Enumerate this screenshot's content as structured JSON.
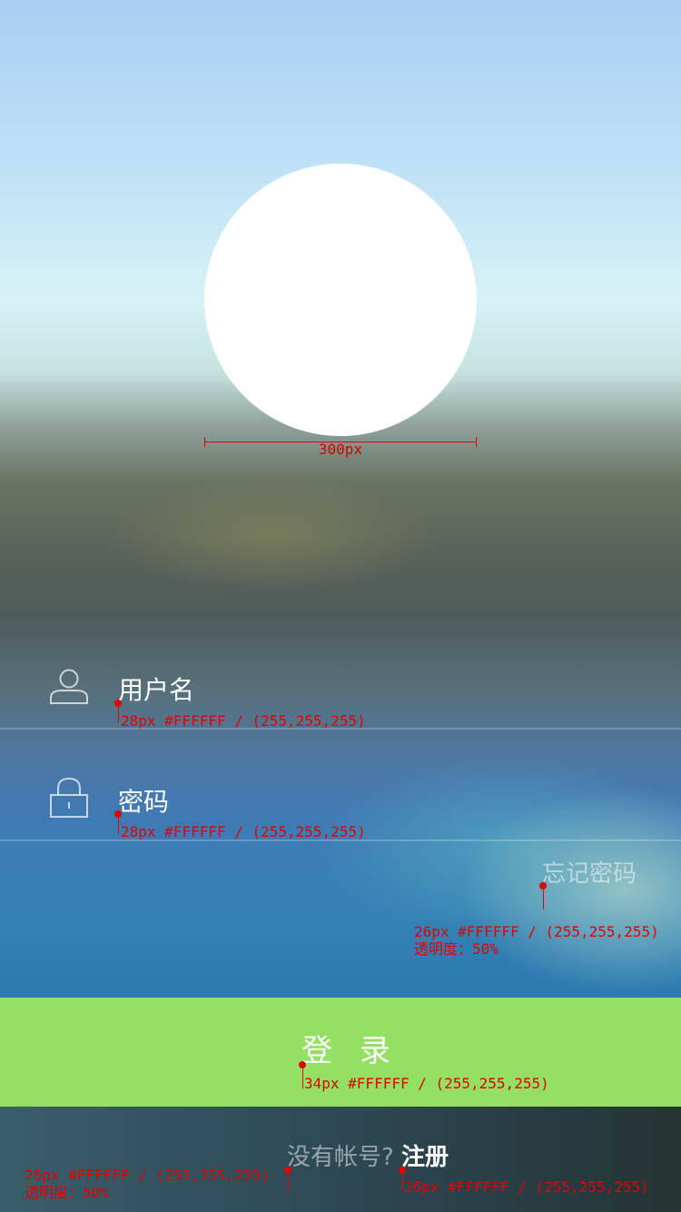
{
  "avatar": {
    "measure_label": "300px"
  },
  "username": {
    "placeholder": "用户名",
    "note": "28px #FFFFFF / (255,255,255)"
  },
  "password": {
    "placeholder": "密码",
    "note": "28px #FFFFFF / (255,255,255)"
  },
  "forgot": {
    "label": "忘记密码",
    "note_line1": "26px #FFFFFF / (255,255,255)",
    "note_line2": "透明度：50%"
  },
  "login": {
    "label": "登录",
    "note": "34px #FFFFFF / (255,255,255)"
  },
  "footer": {
    "question": "没有帐号?",
    "register_label": "注册",
    "question_note_line1": "26px #FFFFFF / (255,255,255)",
    "question_note_line2": "透明度：50%",
    "register_note": "26px #FFFFFF / (255,255,255)"
  },
  "colors": {
    "login_button": "#93e063",
    "annotation": "#e00000"
  },
  "icons": [
    "user-icon",
    "lock-icon"
  ]
}
